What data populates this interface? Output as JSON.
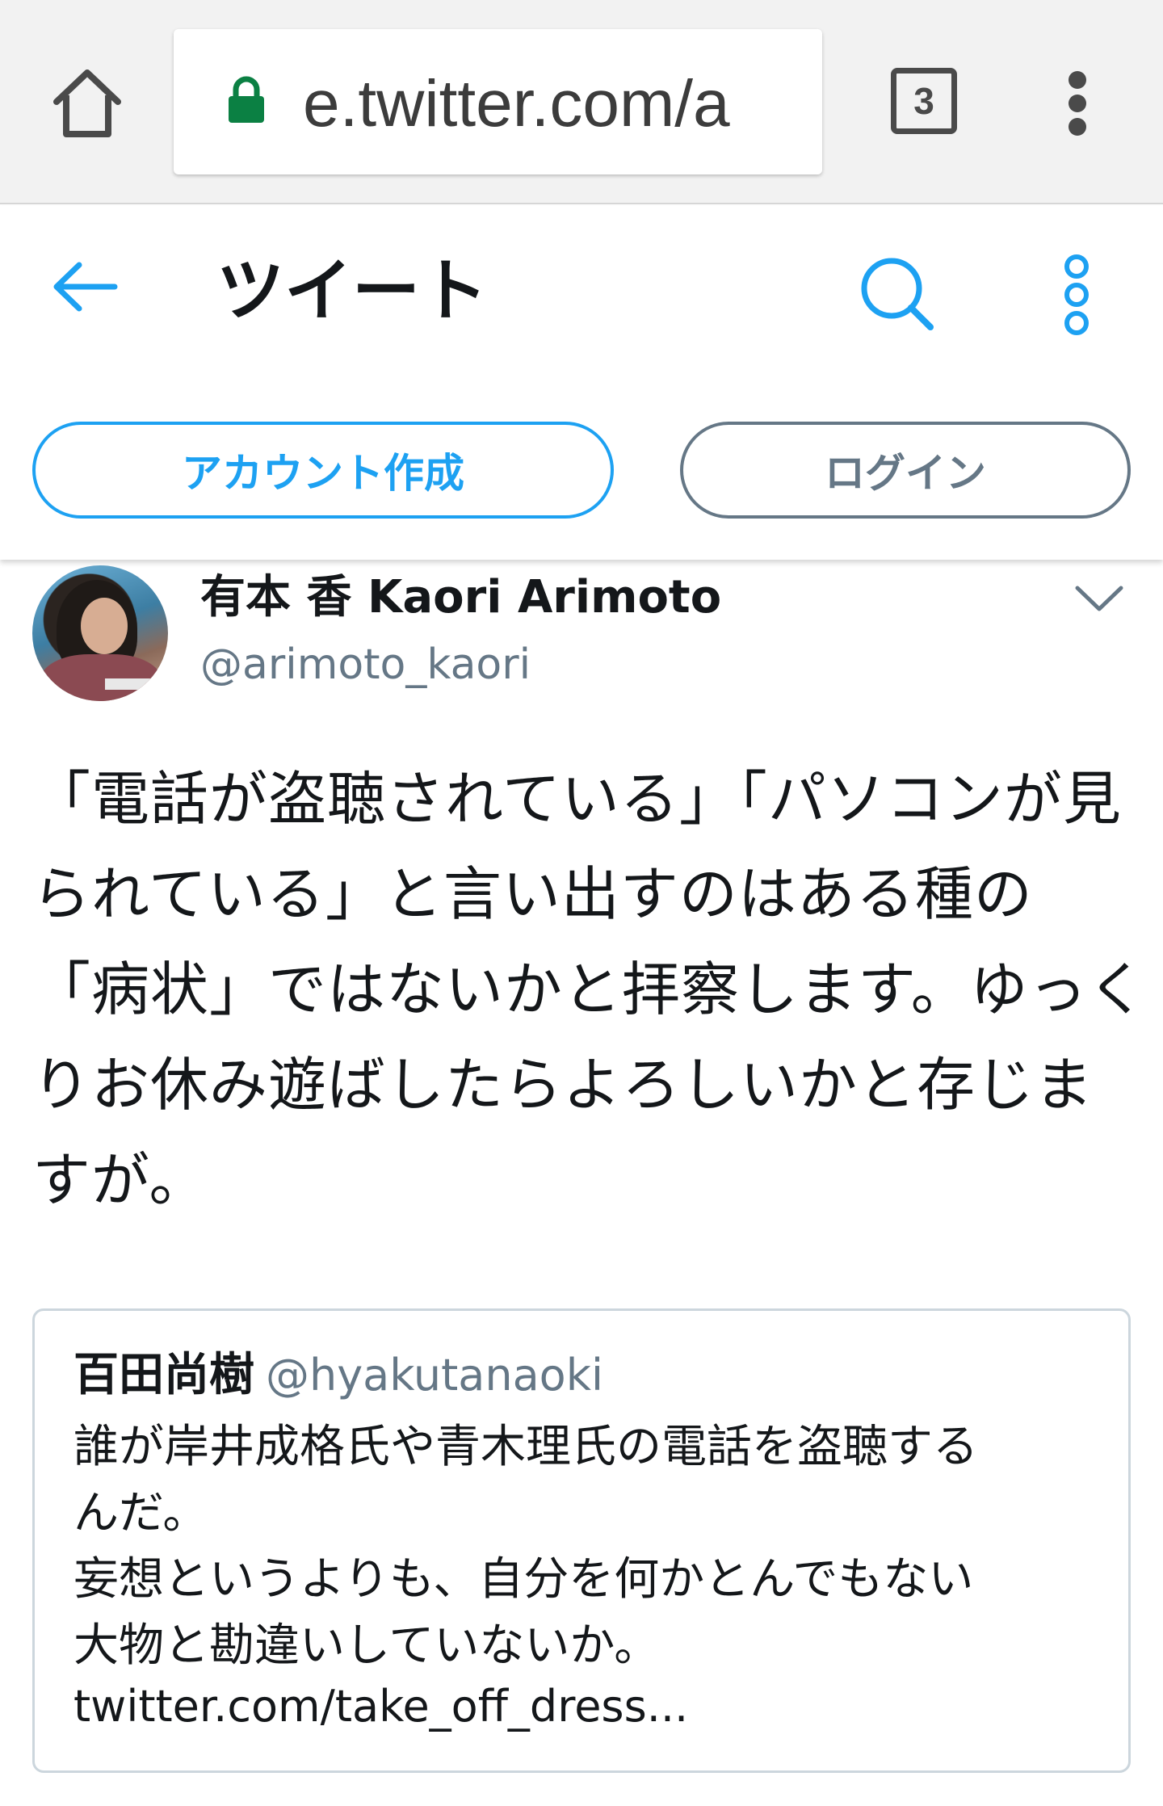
{
  "browser": {
    "url": "e.twitter.com/a",
    "tab_count": "3",
    "icons": {
      "home": "home-icon",
      "lock": "lock-icon",
      "menu": "vertical-dots-icon"
    }
  },
  "header": {
    "title": "ツイート",
    "signup_label": "アカウント作成",
    "login_label": "ログイン",
    "accent_color": "#1da1f2"
  },
  "tweet": {
    "display_name": "有本 香 Kaori Arimoto",
    "username": "@arimoto_kaori",
    "text": "「電話が盗聴されている」「パソコンが見られている」と言い出すのはある種の「病状」ではないかと拝察します。ゆっくりお休み遊ばしたらよろしいかと存じますが。",
    "quote": {
      "display_name": "百田尚樹",
      "username": "@hyakutanaoki",
      "lines": [
        "誰が岸井成格氏や青木理氏の電話を盗聴する",
        "んだ。",
        "妄想というよりも、自分を何かとんでもない",
        "大物と勘違いしていないか。"
      ],
      "link": "twitter.com/take_off_dress..."
    }
  }
}
